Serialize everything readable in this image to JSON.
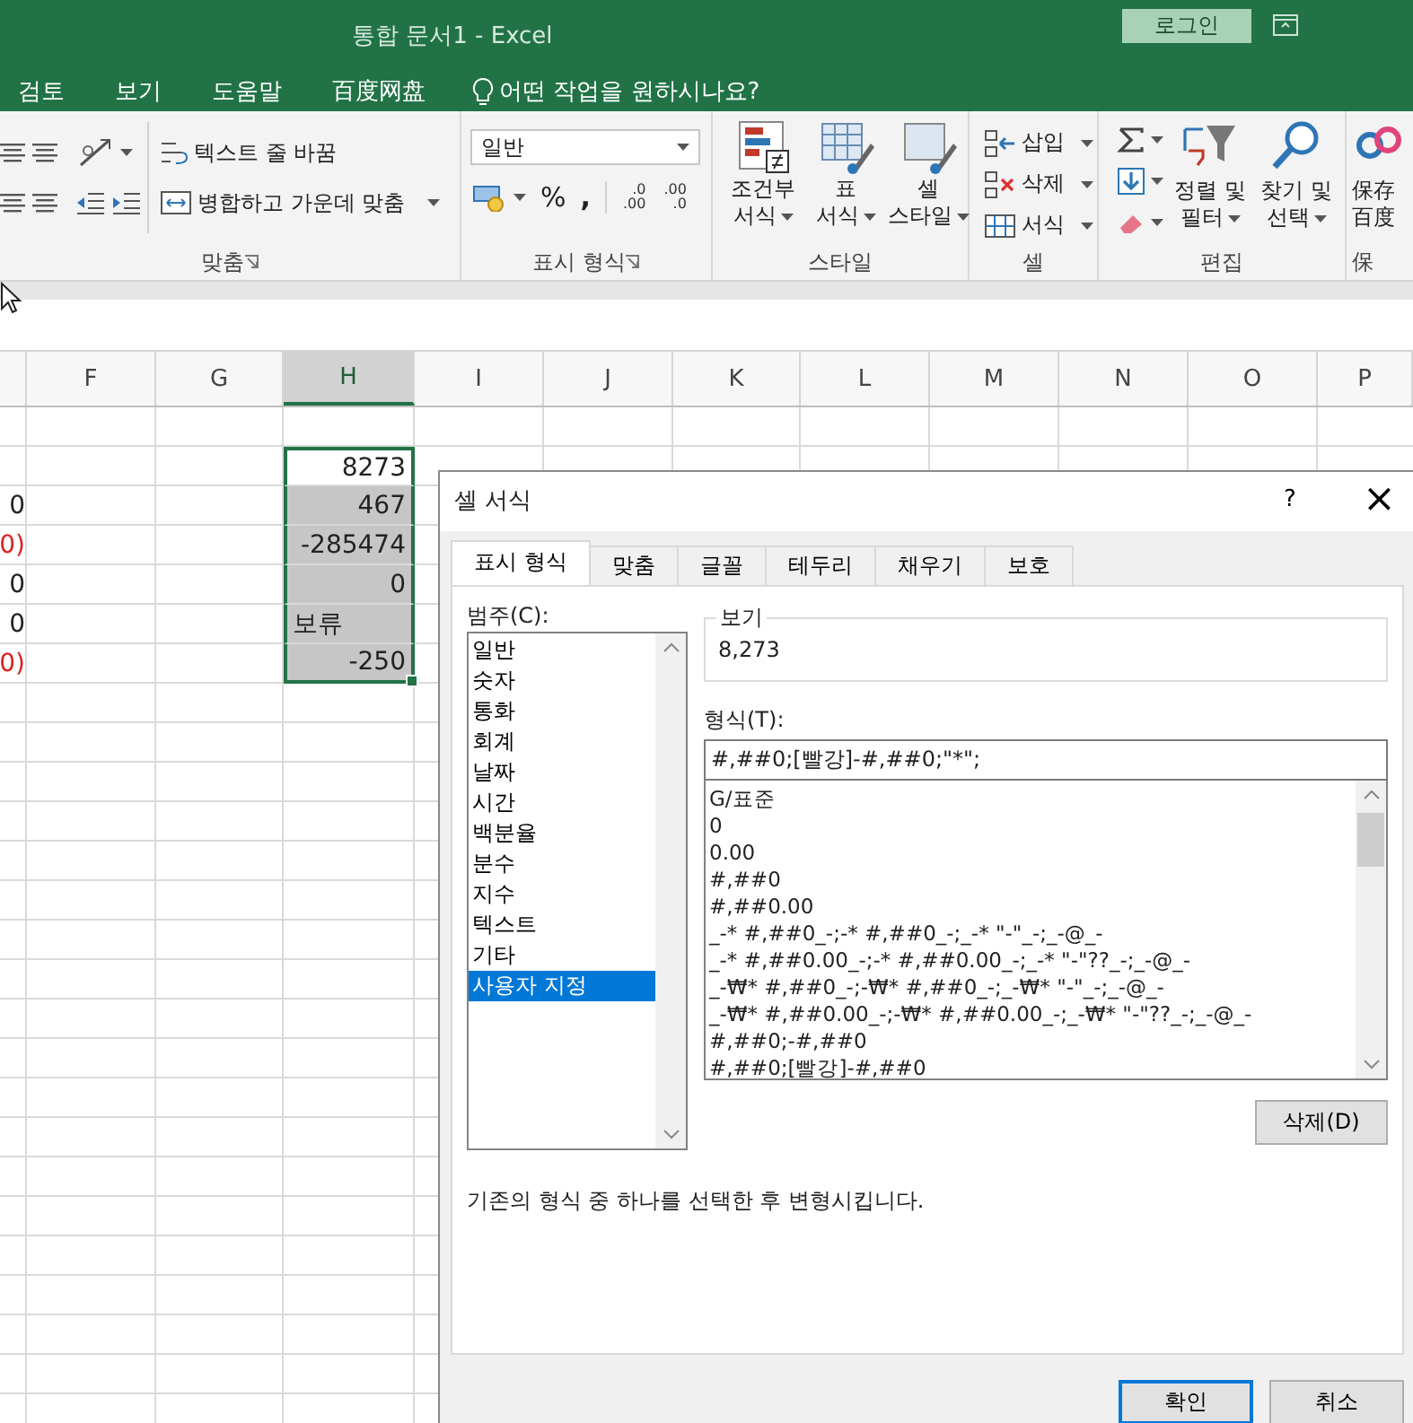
{
  "window": {
    "title": "통합 문서1  -  Excel",
    "login_button": "로그인"
  },
  "menu_tabs": [
    "검토",
    "보기",
    "도움말",
    "百度网盘"
  ],
  "tell_me": "어떤 작업을 원하시나요?",
  "ribbon": {
    "alignment": {
      "wrap_text": "텍스트 줄 바꿈",
      "merge_center": "병합하고 가운데 맞춤",
      "label": "맞춤"
    },
    "number": {
      "format_value": "일반",
      "percent": "%",
      "comma": ",",
      "increase_decimal": [
        ".0",
        ".00"
      ],
      "decrease_decimal": [
        ".00",
        ".0"
      ],
      "label": "표시 형식"
    },
    "styles": {
      "buttons": [
        {
          "kind": "conditional",
          "lines": [
            "조건부",
            "서식"
          ]
        },
        {
          "kind": "table",
          "lines": [
            "표",
            "서식"
          ]
        },
        {
          "kind": "cell",
          "lines": [
            "셀",
            "스타일"
          ]
        }
      ],
      "label": "스타일"
    },
    "cells": {
      "buttons": [
        {
          "kind": "insert",
          "label": "삽입"
        },
        {
          "kind": "delete",
          "label": "삭제"
        },
        {
          "kind": "format",
          "label": "서식"
        }
      ],
      "label": "셀"
    },
    "editing": {
      "buttons": [
        {
          "kind": "sort",
          "lines": [
            "정렬 및",
            "필터"
          ]
        },
        {
          "kind": "find",
          "lines": [
            "찾기 및",
            "선택"
          ]
        }
      ],
      "label": "편집"
    },
    "save": {
      "lines": [
        "保存",
        "百度"
      ],
      "label": "保"
    }
  },
  "sheet": {
    "columns": [
      {
        "label": "F",
        "selected": false
      },
      {
        "label": "G",
        "selected": false
      },
      {
        "label": "H",
        "selected": true
      },
      {
        "label": "I",
        "selected": false
      },
      {
        "label": "J",
        "selected": false
      },
      {
        "label": "K",
        "selected": false
      },
      {
        "label": "L",
        "selected": false
      },
      {
        "label": "M",
        "selected": false
      },
      {
        "label": "N",
        "selected": false
      },
      {
        "label": "O",
        "selected": false
      },
      {
        "label": "P",
        "selected": false
      }
    ],
    "rows": [
      {
        "h": {
          "text": "8273",
          "kind": "number",
          "selected": false,
          "active": true
        }
      },
      {
        "e": {
          "text": "0",
          "negative": false
        },
        "h": {
          "text": "467",
          "kind": "number",
          "selected": true,
          "active": false
        }
      },
      {
        "e": {
          "text": "0)",
          "negative": true
        },
        "h": {
          "text": "-285474",
          "kind": "number",
          "selected": true,
          "active": false
        }
      },
      {
        "e": {
          "text": "0",
          "negative": false
        },
        "h": {
          "text": "0",
          "kind": "number",
          "selected": true,
          "active": false
        }
      },
      {
        "e": {
          "text": "0",
          "negative": false
        },
        "h": {
          "text": "보류",
          "kind": "text",
          "selected": true,
          "active": false
        }
      },
      {
        "e": {
          "text": "0)",
          "negative": true
        },
        "h": {
          "text": "-250",
          "kind": "number",
          "selected": true,
          "active": false
        }
      }
    ]
  },
  "dialog": {
    "title": "셀 서식",
    "help": "?",
    "close": "×",
    "tabs": [
      {
        "label": "표시 형식",
        "selected": true
      },
      {
        "label": "맞춤",
        "selected": false
      },
      {
        "label": "글꼴",
        "selected": false
      },
      {
        "label": "테두리",
        "selected": false
      },
      {
        "label": "채우기",
        "selected": false
      },
      {
        "label": "보호",
        "selected": false
      }
    ],
    "category_label": "범주(C):",
    "categories": [
      {
        "label": "일반",
        "selected": false
      },
      {
        "label": "숫자",
        "selected": false
      },
      {
        "label": "통화",
        "selected": false
      },
      {
        "label": "회계",
        "selected": false
      },
      {
        "label": "날짜",
        "selected": false
      },
      {
        "label": "시간",
        "selected": false
      },
      {
        "label": "백분율",
        "selected": false
      },
      {
        "label": "분수",
        "selected": false
      },
      {
        "label": "지수",
        "selected": false
      },
      {
        "label": "텍스트",
        "selected": false
      },
      {
        "label": "기타",
        "selected": false
      },
      {
        "label": "사용자 지정",
        "selected": true
      }
    ],
    "sample_label": "보기",
    "sample_value": "8,273",
    "format_label": "형식(T):",
    "format_value": "#,##0;[빨강]-#,##0;\"*\";",
    "formats": [
      "G/표준",
      "0",
      "0.00",
      "#,##0",
      "#,##0.00",
      "_-* #,##0_-;-* #,##0_-;_-* \"-\"_-;_-@_-",
      "_-* #,##0.00_-;-* #,##0.00_-;_-* \"-\"??_-;_-@_-",
      "_-₩* #,##0_-;-₩* #,##0_-;_-₩* \"-\"_-;_-@_-",
      "_-₩* #,##0.00_-;-₩* #,##0.00_-;_-₩* \"-\"??_-;_-@_-",
      "#,##0;-#,##0",
      "#,##0;[빨강]-#,##0"
    ],
    "delete_button": "삭제(D)",
    "description": "기존의 형식 중 하나를 선택한 후 변형시킵니다.",
    "ok_button": "확인",
    "cancel_button": "취소"
  }
}
